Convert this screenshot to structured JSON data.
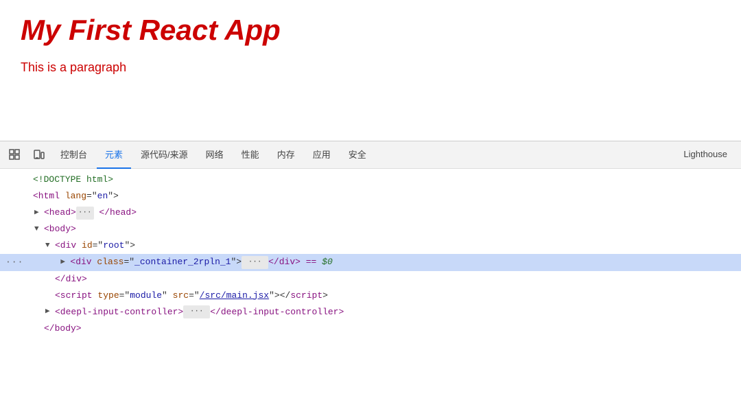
{
  "preview": {
    "title": "My First React App",
    "paragraph": "This is a paragraph"
  },
  "devtools": {
    "icons": [
      "inspect",
      "device"
    ],
    "tabs": [
      {
        "label": "控制台",
        "active": false
      },
      {
        "label": "元素",
        "active": true
      },
      {
        "label": "源代码/来源",
        "active": false
      },
      {
        "label": "网络",
        "active": false
      },
      {
        "label": "性能",
        "active": false
      },
      {
        "label": "内存",
        "active": false
      },
      {
        "label": "应用",
        "active": false
      },
      {
        "label": "安全",
        "active": false
      },
      {
        "label": "Lighthouse",
        "active": false
      }
    ],
    "dom": [
      {
        "id": "doctype",
        "indent": 0,
        "text": "<!DOCTYPE html>",
        "arrow": "none"
      },
      {
        "id": "html",
        "indent": 0,
        "text": "<html lang=\"en\">",
        "arrow": "none"
      },
      {
        "id": "head",
        "indent": 1,
        "text": "<head>",
        "arrow": "right",
        "dots": true,
        "close": "</head>"
      },
      {
        "id": "body-open",
        "indent": 1,
        "text": "<body>",
        "arrow": "down"
      },
      {
        "id": "div-root",
        "indent": 2,
        "text": "<div id=\"root\">",
        "arrow": "down"
      },
      {
        "id": "div-container",
        "indent": 3,
        "text": "<div class=\"_container_2rpln_1\">",
        "arrow": "right",
        "dots": true,
        "close": "</div>",
        "highlighted": true,
        "eq": "== $0"
      },
      {
        "id": "div-close",
        "indent": 2,
        "text": "</div>"
      },
      {
        "id": "script",
        "indent": 2,
        "text_parts": [
          "<script type=\"module\" src=\"",
          "/src/main.jsx",
          "\"></",
          "script",
          ">"
        ],
        "has_link": true
      },
      {
        "id": "deepl",
        "indent": 2,
        "text": "<deepl-input-controller>",
        "arrow": "right",
        "dots": true,
        "close": "</deepl-input-controller>"
      },
      {
        "id": "body-close",
        "indent": 1,
        "text": "</body>"
      }
    ]
  }
}
